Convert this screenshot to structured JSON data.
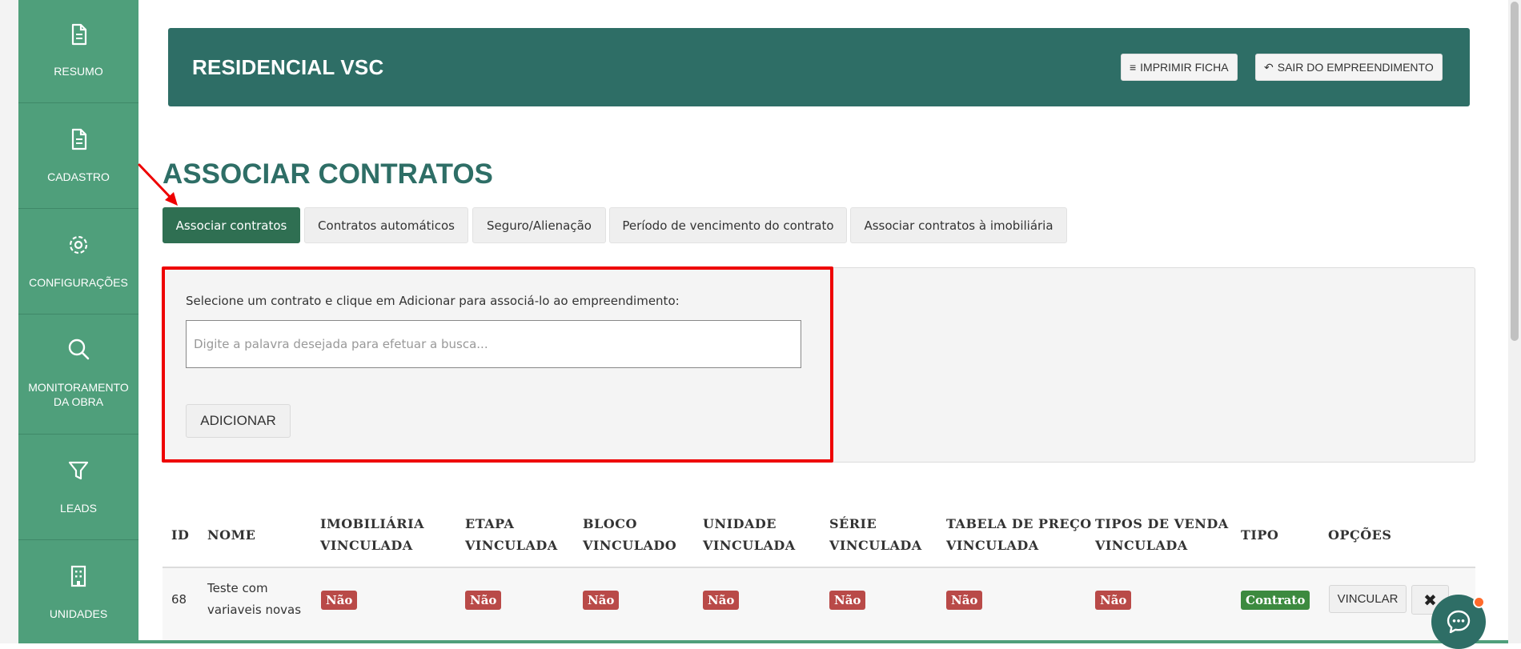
{
  "sidebar": {
    "items": [
      {
        "label": "RESUMO",
        "icon": "document-icon"
      },
      {
        "label": "CADASTRO",
        "icon": "document-icon"
      },
      {
        "label": "CONFIGURAÇÕES",
        "icon": "gear-icon"
      },
      {
        "label_line1": "MONITORAMENTO",
        "label_line2": "DA OBRA",
        "icon": "search-icon"
      },
      {
        "label": "LEADS",
        "icon": "funnel-icon"
      },
      {
        "label": "UNIDADES",
        "icon": "building-icon"
      }
    ]
  },
  "header": {
    "title": "RESIDENCIAL VSC",
    "print_label": "IMPRIMIR FICHA",
    "exit_label": "SAIR DO EMPREENDIMENTO"
  },
  "page": {
    "title": "ASSOCIAR CONTRATOS"
  },
  "tabs": [
    {
      "label": "Associar contratos",
      "active": true
    },
    {
      "label": "Contratos automáticos",
      "active": false
    },
    {
      "label": "Seguro/Alienação",
      "active": false
    },
    {
      "label": "Período de vencimento do contrato",
      "active": false
    },
    {
      "label": "Associar contratos à imobiliária",
      "active": false
    }
  ],
  "form": {
    "instruction": "Selecione um contrato e clique em Adicionar para associá-lo ao empreendimento:",
    "search_placeholder": "Digite a palavra desejada para efetuar a busca...",
    "search_value": "",
    "add_label": "ADICIONAR"
  },
  "table": {
    "headers": {
      "id": "ID",
      "nome": "NOME",
      "imobiliaria_1": "IMOBILIÁRIA",
      "imobiliaria_2": "VINCULADA",
      "etapa_1": "ETAPA",
      "etapa_2": "VINCULADA",
      "bloco_1": "BLOCO",
      "bloco_2": "VINCULADO",
      "unidade_1": "UNIDADE",
      "unidade_2": "VINCULADA",
      "serie_1": "SÉRIE",
      "serie_2": "VINCULADA",
      "tabela_1": "TABELA DE PREÇO",
      "tabela_2": "VINCULADA",
      "tipos_1": "TIPOS DE VENDA",
      "tipos_2": "VINCULADA",
      "tipo": "TIPO",
      "opcoes": "OPÇÕES"
    },
    "rows": [
      {
        "id": "68",
        "nome_1": "Teste com",
        "nome_2": "variaveis novas",
        "imobiliaria": "Não",
        "etapa": "Não",
        "bloco": "Não",
        "unidade": "Não",
        "serie": "Não",
        "tabela": "Não",
        "tipos": "Não",
        "tipo": "Contrato",
        "vincular_label": "VINCULAR"
      }
    ]
  },
  "colors": {
    "sidebar": "#4f9f7b",
    "header": "#2e6e66",
    "active_tab": "#2f6f52",
    "highlight_box": "#ee0000",
    "badge_no": "#b94a48",
    "badge_type": "#3c8a3f",
    "chat_notification": "#ff6a2b"
  }
}
